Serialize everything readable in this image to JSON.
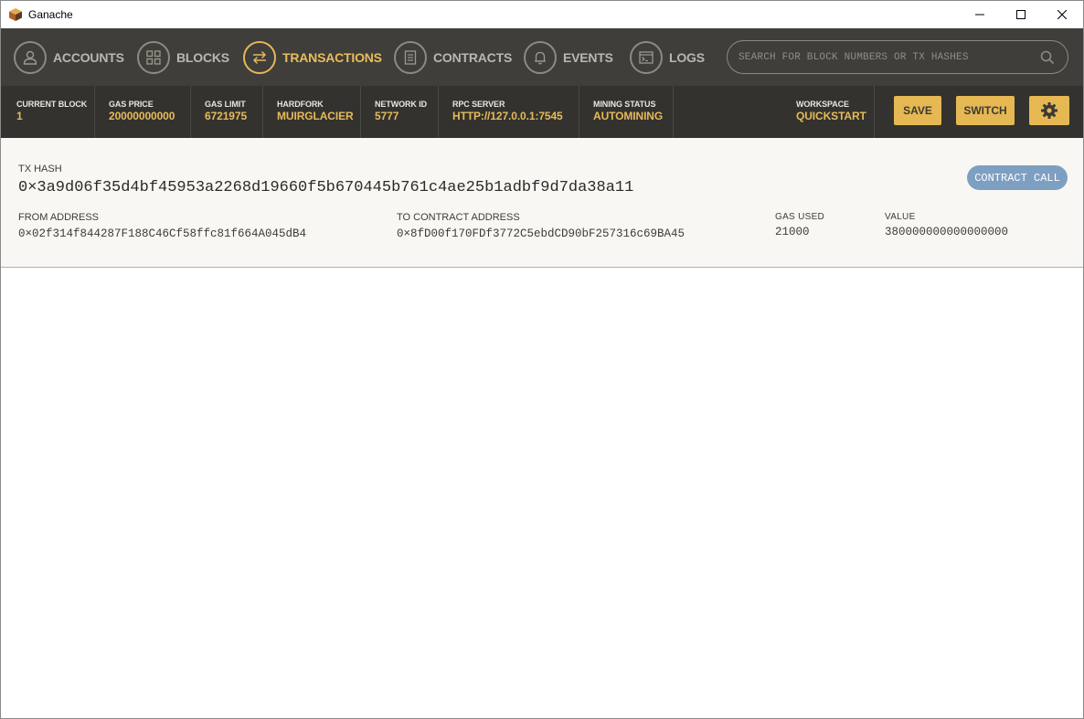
{
  "window": {
    "title": "Ganache",
    "icon": "ganache-logo-icon"
  },
  "nav": {
    "items": [
      {
        "label": "ACCOUNTS",
        "icon": "user-icon",
        "active": false
      },
      {
        "label": "BLOCKS",
        "icon": "grid-icon",
        "active": false
      },
      {
        "label": "TRANSACTIONS",
        "icon": "arrows-exchange-icon",
        "active": true
      },
      {
        "label": "CONTRACTS",
        "icon": "document-icon",
        "active": false
      },
      {
        "label": "EVENTS",
        "icon": "bell-icon",
        "active": false
      },
      {
        "label": "LOGS",
        "icon": "terminal-icon",
        "active": false
      }
    ],
    "search_placeholder": "SEARCH FOR BLOCK NUMBERS OR TX HASHES"
  },
  "status": {
    "current_block_label": "CURRENT BLOCK",
    "current_block": "1",
    "gas_price_label": "GAS PRICE",
    "gas_price": "20000000000",
    "gas_limit_label": "GAS LIMIT",
    "gas_limit": "6721975",
    "hardfork_label": "HARDFORK",
    "hardfork": "MUIRGLACIER",
    "network_id_label": "NETWORK ID",
    "network_id": "5777",
    "rpc_server_label": "RPC SERVER",
    "rpc_server": "HTTP://127.0.0.1:7545",
    "mining_status_label": "MINING STATUS",
    "mining_status": "AUTOMINING",
    "workspace_label": "WORKSPACE",
    "workspace": "QUICKSTART",
    "save_label": "SAVE",
    "switch_label": "SWITCH"
  },
  "tx": {
    "hash_label": "TX HASH",
    "hash": "0×3a9d06f35d4bf45953a2268d19660f5b670445b761c4ae25b1adbf9d7da38a11",
    "type_badge": "CONTRACT CALL",
    "from_label": "FROM ADDRESS",
    "from": "0×02f314f844287F188C46Cf58ffc81f664A045dB4",
    "to_label": "TO CONTRACT ADDRESS",
    "to": "0×8fD00f170FDf3772C5ebdCD90bF257316c69BA45",
    "gas_used_label": "GAS USED",
    "gas_used": "21000",
    "value_label": "VALUE",
    "value": "380000000000000000"
  },
  "colors": {
    "nav_bg": "#3f3e3a",
    "status_bg": "#33322e",
    "accent_gold": "#e6b853",
    "badge_blue": "#7d9fc2",
    "panel_bg": "#f8f7f3"
  }
}
